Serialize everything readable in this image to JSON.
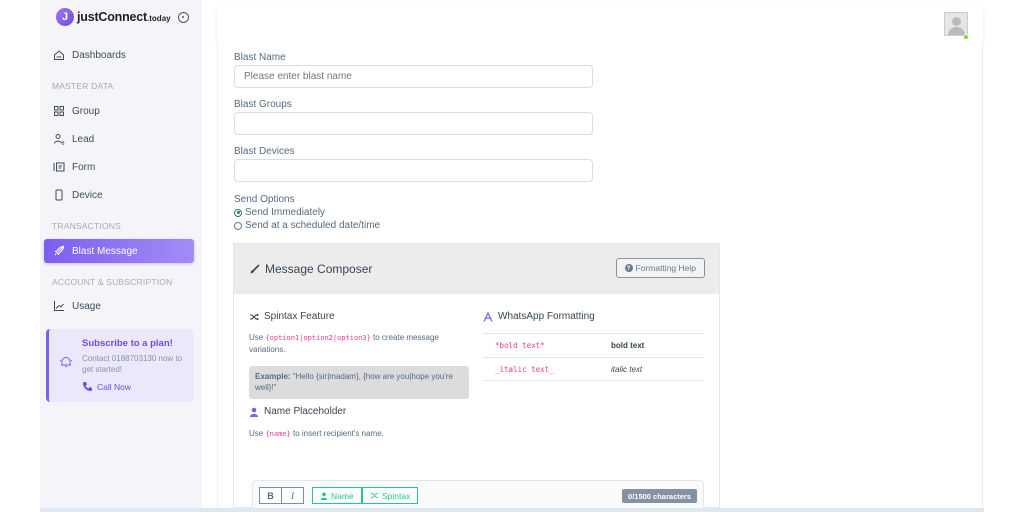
{
  "brand": {
    "logo_letter": "J",
    "name": "justConnect",
    "suffix": ".today"
  },
  "sidebar": {
    "items": [
      {
        "label": "Dashboards",
        "icon": "home-icon"
      },
      {
        "label": "Group",
        "icon": "grid-icon"
      },
      {
        "label": "Lead",
        "icon": "user-dollar-icon"
      },
      {
        "label": "Form",
        "icon": "form-icon"
      },
      {
        "label": "Device",
        "icon": "phone-icon"
      },
      {
        "label": "Blast Message",
        "icon": "rocket-icon",
        "active": true
      },
      {
        "label": "Usage",
        "icon": "chart-icon"
      }
    ],
    "headers": [
      "MASTER DATA",
      "TRANSACTIONS",
      "ACCOUNT & SUBSCRIPTION"
    ],
    "promo": {
      "title": "Subscribe to a plan!",
      "text": "Contact 0188703130 now to get started!",
      "link": "Call Now"
    }
  },
  "form": {
    "blast_name": {
      "label": "Blast Name",
      "placeholder": "Please enter blast name"
    },
    "blast_groups": {
      "label": "Blast Groups",
      "value": ""
    },
    "blast_devices": {
      "label": "Blast Devices",
      "value": ""
    },
    "send_options": {
      "label": "Send Options",
      "options": [
        "Send Immediately",
        "Send at a scheduled date/time"
      ],
      "selected": "Send Immediately"
    }
  },
  "composer": {
    "title": "Message Composer",
    "help_button": "Formatting Help",
    "spintax": {
      "title": "Spintax Feature",
      "text_before": "Use ",
      "code": "{option1|option2|option3}",
      "text_after": " to create message variations.",
      "example_label": "Example:",
      "example_text": " \"Hello {sir|madam}, {how are you|hope you're well}!\""
    },
    "placeholder": {
      "title": "Name Placeholder",
      "text_before": "Use ",
      "code": "{name}",
      "text_after": " to insert recipient's name."
    },
    "whatsapp": {
      "title": "WhatsApp Formatting",
      "rows": [
        {
          "syntax": "*bold text*",
          "result": "bold text"
        },
        {
          "syntax": "_italic text_",
          "result": "italic text"
        }
      ]
    },
    "toolbar": {
      "bold": "B",
      "italic": "I",
      "name_button": "Name",
      "spintax_button": "Spintax",
      "char_count": "0/1500 characters"
    }
  },
  "colors": {
    "accent": "#7c5ef0",
    "code": "#e83e8c",
    "green": "#20c997",
    "online": "#71dd37"
  }
}
